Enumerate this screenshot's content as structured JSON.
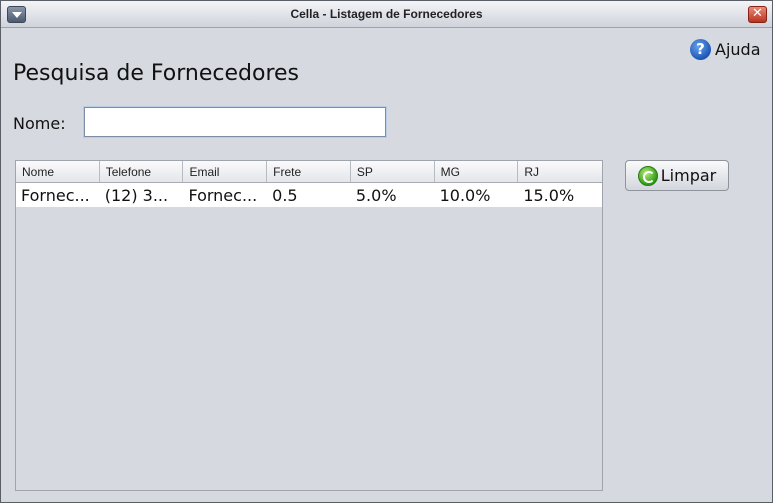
{
  "window": {
    "title": "Cella - Listagem de Fornecedores",
    "close_glyph": "✕"
  },
  "help": {
    "glyph": "?",
    "label": "Ajuda"
  },
  "page": {
    "title": "Pesquisa de Fornecedores"
  },
  "search": {
    "label": "Nome:",
    "value": ""
  },
  "actions": {
    "clear_label": "Limpar"
  },
  "table": {
    "columns": [
      "Nome",
      "Telefone",
      "Email",
      "Frete",
      "SP",
      "MG",
      "RJ"
    ],
    "rows": [
      [
        "Fornec...",
        "(12) 3...",
        "Fornec...",
        "0.5",
        "5.0%",
        "10.0%",
        "15.0%"
      ]
    ]
  },
  "icons": {
    "menu": "chevron-down-icon",
    "close": "close-icon",
    "help": "help-icon",
    "clear": "refresh-icon"
  },
  "colors": {
    "background": "#d6d9e0",
    "close_button": "#b83320",
    "help_icon": "#1b56b7",
    "clear_icon": "#2f9a16"
  }
}
